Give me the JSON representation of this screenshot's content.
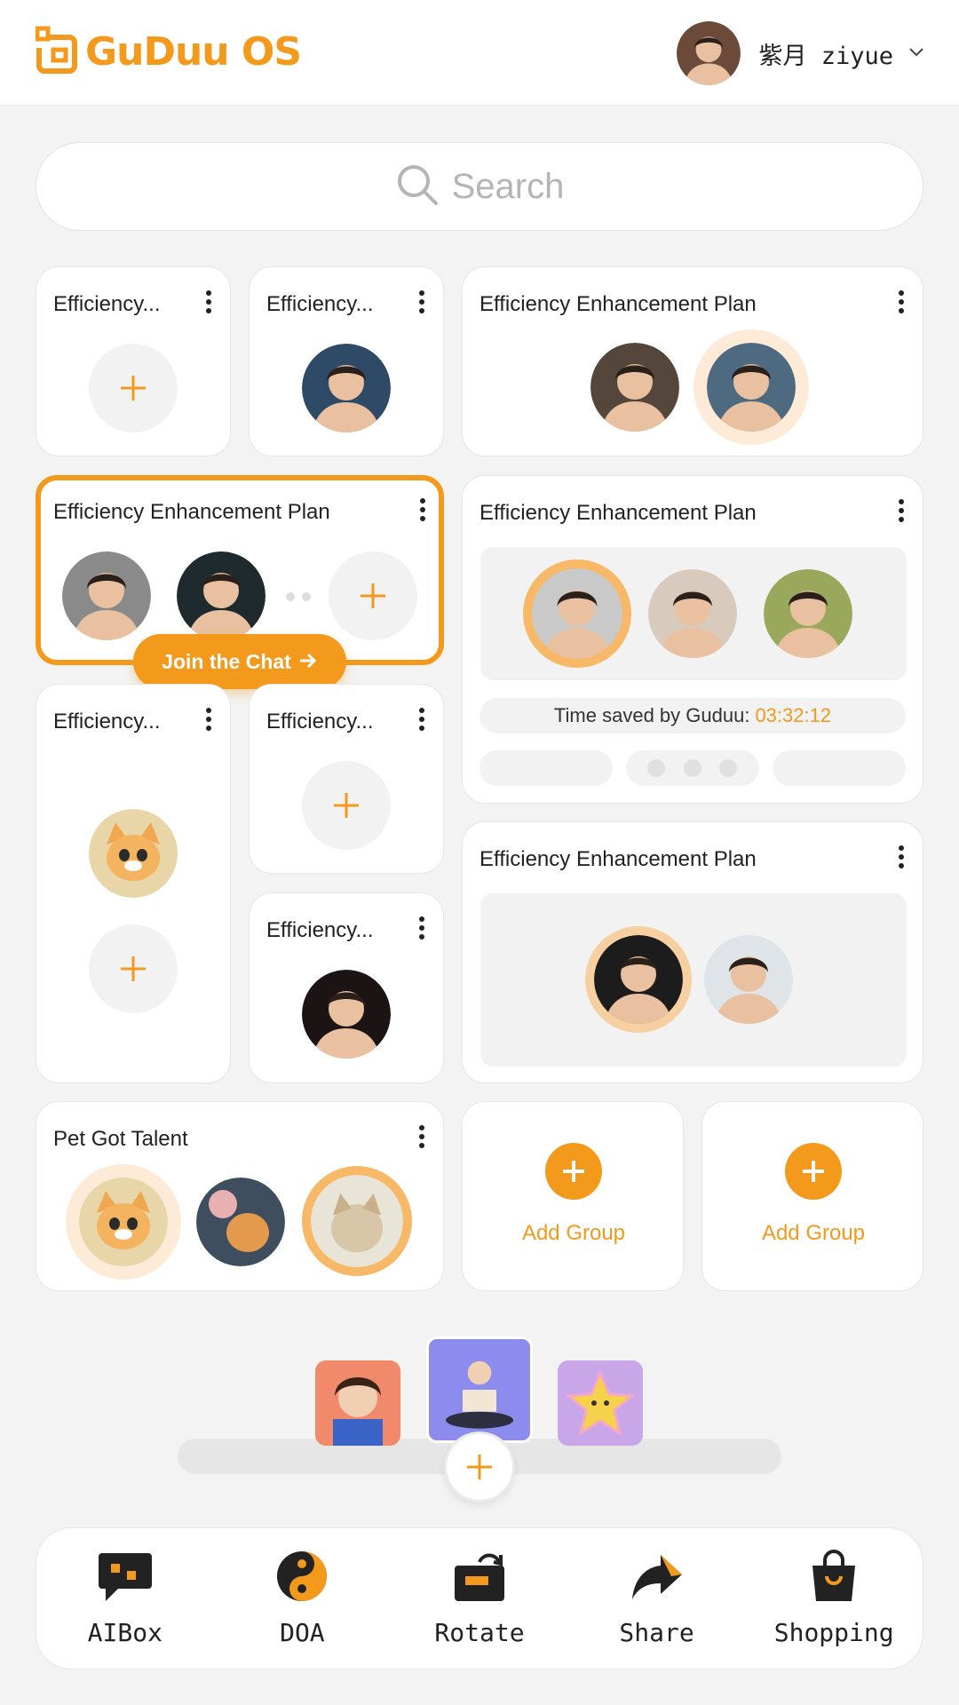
{
  "header": {
    "app_name": "GuDuu OS",
    "user_name": "紫月 ziyue"
  },
  "search": {
    "placeholder": "Search"
  },
  "cards": {
    "c1_title": "Efficiency...",
    "c2_title": "Efficiency...",
    "c3_title": "Efficiency Enhancement Plan",
    "c4_title": "Efficiency Enhancement Plan",
    "c5_title": "Efficiency Enhancement Plan",
    "c6_title": "Efficiency...",
    "c7_title": "Efficiency...",
    "c8_title": "Efficiency...",
    "c9_title": "Efficiency Enhancement Plan",
    "c10_title": "Pet Got Talent",
    "join_label": "Join the Chat",
    "time_label": "Time saved by Guduu:",
    "time_value": "03:32:12",
    "add_group_1": "Add Group",
    "add_group_2": "Add Group"
  },
  "dock": {
    "items": [
      {
        "label": "AIBox",
        "icon": "chat-box-icon"
      },
      {
        "label": "DOA",
        "icon": "yin-yang-icon"
      },
      {
        "label": "Rotate",
        "icon": "rotate-icon"
      },
      {
        "label": "Share",
        "icon": "share-arrow-icon"
      },
      {
        "label": "Shopping",
        "icon": "shopping-bag-icon"
      }
    ]
  },
  "colors": {
    "accent": "#f39a1c",
    "background": "#f3f3f3",
    "card": "#ffffff"
  }
}
